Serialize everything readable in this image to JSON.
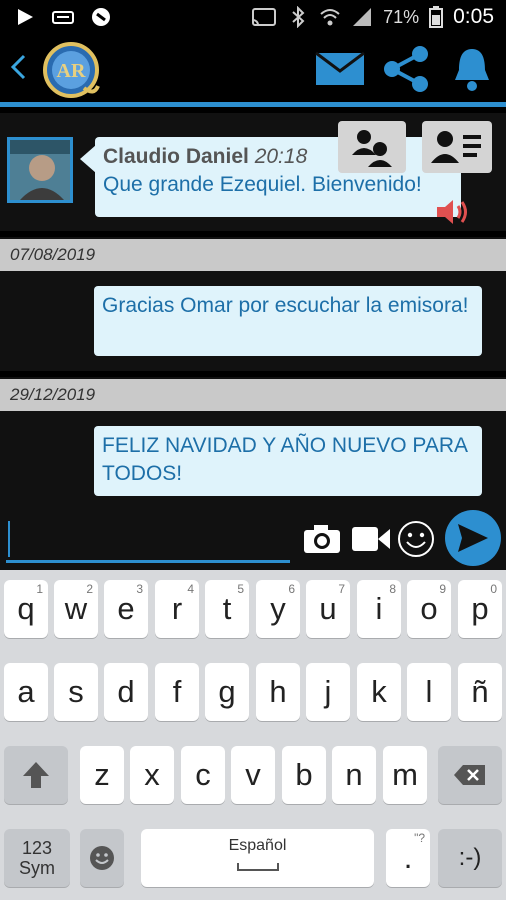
{
  "status_bar": {
    "battery": "71%",
    "time": "0:05"
  },
  "app_bar": {
    "logo_text": "AR",
    "actions": [
      "mail-icon",
      "share-icon",
      "bell-icon"
    ]
  },
  "chat": {
    "header_chips": [
      "group-icon",
      "contact-card-icon"
    ],
    "messages": [
      {
        "sender": "Claudio Daniel",
        "time": "20:18",
        "text": "Que grande Ezequiel. Bienvenido!"
      },
      {
        "date": "07/08/2019",
        "text": "Gracias Omar por escuchar la emisora!"
      },
      {
        "date": "29/12/2019",
        "text": "FELIZ NAVIDAD Y AÑO NUEVO PARA TODOS!"
      }
    ]
  },
  "composer": {
    "value": "",
    "placeholder": ""
  },
  "keyboard": {
    "row1": [
      {
        "k": "q",
        "s": "1"
      },
      {
        "k": "w",
        "s": "2"
      },
      {
        "k": "e",
        "s": "3"
      },
      {
        "k": "r",
        "s": "4"
      },
      {
        "k": "t",
        "s": "5"
      },
      {
        "k": "y",
        "s": "6"
      },
      {
        "k": "u",
        "s": "7"
      },
      {
        "k": "i",
        "s": "8"
      },
      {
        "k": "o",
        "s": "9"
      },
      {
        "k": "p",
        "s": "0"
      }
    ],
    "row2": [
      "a",
      "s",
      "d",
      "f",
      "g",
      "h",
      "j",
      "k",
      "l",
      "ñ"
    ],
    "row3": [
      "z",
      "x",
      "c",
      "v",
      "b",
      "n",
      "m"
    ],
    "sym_label": "123\nSym",
    "space_label": "Español",
    "period": ".",
    "period_sup": "\"?",
    "emoticon": ":-)"
  },
  "colors": {
    "accent": "#2d8fd0",
    "bubble": "#dff3fb",
    "bubble_text": "#1d6fa8"
  }
}
